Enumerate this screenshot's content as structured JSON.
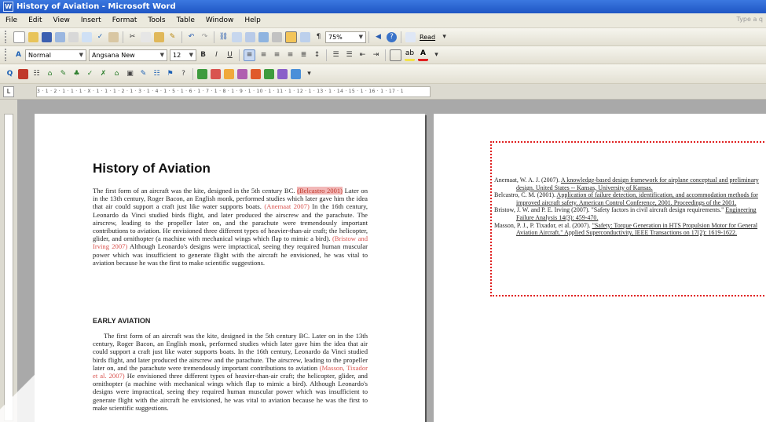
{
  "window": {
    "title": "History of Aviation - Microsoft Word"
  },
  "menu": {
    "items": [
      "File",
      "Edit",
      "View",
      "Insert",
      "Format",
      "Tools",
      "Table",
      "Window",
      "Help"
    ],
    "help_placeholder": "Type a q"
  },
  "toolbar1": {
    "zoom": "75%",
    "read_label": "Read"
  },
  "toolbar2": {
    "style": "Normal",
    "font": "Angsana New",
    "size": "12"
  },
  "ruler": {
    "scale": "3 · 1 · 2 · 1 · 1 · 1 · X · 1 · 1 · 1 · 2 · 1 · 3 · 1 · 4 · 1 · 5 · 1 · 6 · 1 · 7 · 1 · 8 · 1 · 9 · 1 · 10 · 1 · 11 · 1 · 12 · 1 · 13 · 1 · 14 · 15 · 1 · 16 · 1 · 17 · 1"
  },
  "document": {
    "title": "History of Aviation",
    "para1": {
      "a": "The first form of an aircraft was the kite, designed in the 5th century BC.",
      "cite1": "(Belcastro 2001)",
      "b": " Later on in the 13th century, Roger Bacon, an English monk, performed studies which later gave him the idea that air could support a craft just like water supports boats.",
      "cite2": "(Anemaat 2007)",
      "c": " In the 16th century, Leonardo da Vinci studied birds flight, and later produced the airscrew and the parachute. The airscrew, leading to the propeller later on, and the parachute were tremendously important contributions to aviation. He envisioned three different types of heavier-than-air craft; the helicopter, glider, and ornithopter (a machine with mechanical wings which flap to mimic a bird).",
      "cite3": "(Bristow and Irving 2007)",
      "d": " Although Leonardo's designs were impractical, seeing they required human muscular power which was insufficient to generate flight with the aircraft he envisioned, he was vital to aviation because he was the first to make scientific suggestions."
    },
    "heading2": "EARLY AVIATION",
    "para2": {
      "a": "The first form of an aircraft was the kite, designed in the 5th century BC. Later on in the 13th century, Roger Bacon, an English monk, performed studies which later gave him the idea that air could support a craft just like water supports boats. In the 16th century, Leonardo da Vinci studied birds flight, and later produced the airscrew and the parachute. The airscrew, leading to the propeller later on, and the parachute were tremendously important contributions to aviation",
      "cite": "(Masson, Tixador et al. 2007)",
      "b": " He envisioned three different types of heavier-than-air craft; the helicopter, glider, and ornithopter (a machine with mechanical wings which flap to mimic a bird). Although Leonardo's designs were impractical, seeing they required human muscular power which was insufficient to generate flight with the aircraft he envisioned, he was vital to aviation because he was the first to make scientific suggestions."
    },
    "references": [
      {
        "authors": "Anemaat, W. A. J. (2007). ",
        "title": "A knowledge-based design framework for airplane conceptual and preliminary design. United States -- Kansas, University of Kansas."
      },
      {
        "authors": "Belcastro, C. M. (2001). ",
        "title": "Application of failure detection, identification, and accommodation methods for improved aircraft safety. American Control Conference, 2001. Proceedings of the 2001."
      },
      {
        "authors": "Bristow, J. W. and P. E. Irving (2007). \"Safety factors in civil aircraft design requirements.\" ",
        "title": "Engineering Failure Analysis 14(3): 459-470."
      },
      {
        "authors": "Masson, P. J., P. Tixador, et al. (2007). ",
        "title": "\"Safety: Torque Generation in HTS Propulsion Motor for General Aviation Aircraft.\" Applied Superconductivity, IEEE Transactions on 17(2): 1619-1622."
      }
    ]
  }
}
